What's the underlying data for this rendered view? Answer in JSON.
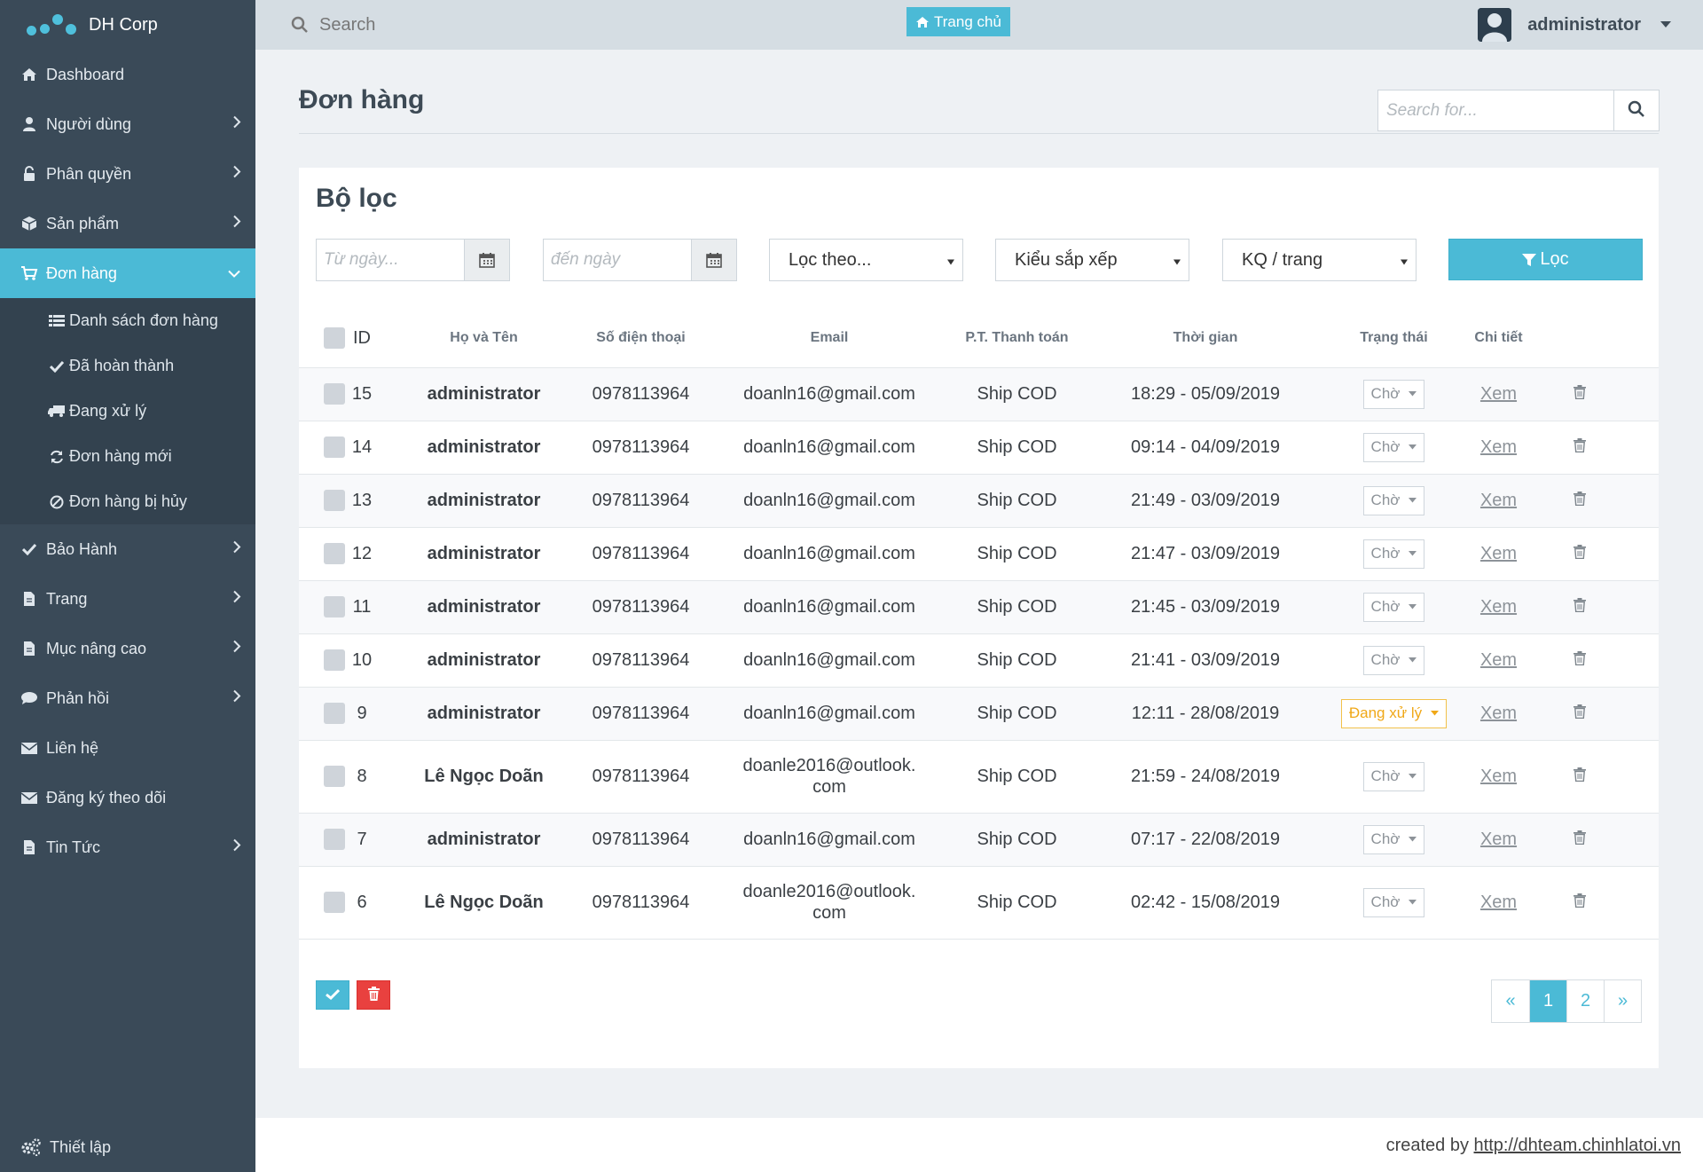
{
  "brand": {
    "name": "DH Corp",
    "logo_color": "#4fc0dc"
  },
  "sidebar": {
    "items": [
      {
        "label": "Dashboard",
        "icon": "home-icon"
      },
      {
        "label": "Người dùng",
        "icon": "user-icon"
      },
      {
        "label": "Phân quyền",
        "icon": "unlock-icon"
      },
      {
        "label": "Sản phẩm",
        "icon": "cube-icon"
      },
      {
        "label": "Đơn hàng",
        "icon": "cart-icon"
      },
      {
        "label": "Bảo Hành",
        "icon": "check-icon"
      },
      {
        "label": "Trang",
        "icon": "file-icon"
      },
      {
        "label": "Mục nâng cao",
        "icon": "file-icon"
      },
      {
        "label": "Phản hồi",
        "icon": "comment-icon"
      },
      {
        "label": "Liên hệ",
        "icon": "envelope-icon"
      },
      {
        "label": "Đăng ký theo dõi",
        "icon": "envelope-icon"
      },
      {
        "label": "Tin Tức",
        "icon": "file-icon"
      }
    ],
    "subitems": [
      {
        "label": "Danh sách đơn hàng",
        "icon": "list-icon"
      },
      {
        "label": "Đã hoàn thành",
        "icon": "check-icon"
      },
      {
        "label": "Đang xử lý",
        "icon": "truck-icon"
      },
      {
        "label": "Đơn hàng mới",
        "icon": "refresh-icon"
      },
      {
        "label": "Đơn hàng bị hủy",
        "icon": "ban-icon"
      }
    ],
    "settings_label": "Thiết lập",
    "accent": "#4bbad6"
  },
  "topbar": {
    "search_label": "Search",
    "home_label": "Trang chủ",
    "username": "administrator"
  },
  "page": {
    "title": "Đơn hàng",
    "search_placeholder": "Search for..."
  },
  "filter": {
    "title": "Bộ lọc",
    "from_placeholder": "Từ ngày...",
    "to_placeholder": "đến ngày",
    "filter_by": "Lọc theo...",
    "sort_type": "Kiểu sắp xếp",
    "per_page": "KQ / trang",
    "button_label": "Lọc"
  },
  "table": {
    "headers": [
      "ID",
      "Họ và Tên",
      "Số điện thoại",
      "Email",
      "P.T. Thanh toán",
      "Thời gian",
      "Trạng thái",
      "Chi tiết"
    ],
    "detail_label": "Xem",
    "rows": [
      {
        "id": "15",
        "name": "administrator",
        "phone": "0978113964",
        "email_1": "doanln16@gmail.com",
        "email_2": "",
        "payment": "Ship COD",
        "time": "18:29 - 05/09/2019",
        "status": "Chờ"
      },
      {
        "id": "14",
        "name": "administrator",
        "phone": "0978113964",
        "email_1": "doanln16@gmail.com",
        "email_2": "",
        "payment": "Ship COD",
        "time": "09:14 - 04/09/2019",
        "status": "Chờ"
      },
      {
        "id": "13",
        "name": "administrator",
        "phone": "0978113964",
        "email_1": "doanln16@gmail.com",
        "email_2": "",
        "payment": "Ship COD",
        "time": "21:49 - 03/09/2019",
        "status": "Chờ"
      },
      {
        "id": "12",
        "name": "administrator",
        "phone": "0978113964",
        "email_1": "doanln16@gmail.com",
        "email_2": "",
        "payment": "Ship COD",
        "time": "21:47 - 03/09/2019",
        "status": "Chờ"
      },
      {
        "id": "11",
        "name": "administrator",
        "phone": "0978113964",
        "email_1": "doanln16@gmail.com",
        "email_2": "",
        "payment": "Ship COD",
        "time": "21:45 - 03/09/2019",
        "status": "Chờ"
      },
      {
        "id": "10",
        "name": "administrator",
        "phone": "0978113964",
        "email_1": "doanln16@gmail.com",
        "email_2": "",
        "payment": "Ship COD",
        "time": "21:41 - 03/09/2019",
        "status": "Chờ"
      },
      {
        "id": "9",
        "name": "administrator",
        "phone": "0978113964",
        "email_1": "doanln16@gmail.com",
        "email_2": "",
        "payment": "Ship COD",
        "time": "12:11 - 28/08/2019",
        "status": "Đang xử lý"
      },
      {
        "id": "8",
        "name": "Lê Ngọc Doãn",
        "phone": "0978113964",
        "email_1": "doanle2016@outlook.",
        "email_2": "com",
        "payment": "Ship COD",
        "time": "21:59 - 24/08/2019",
        "status": "Chờ"
      },
      {
        "id": "7",
        "name": "administrator",
        "phone": "0978113964",
        "email_1": "doanln16@gmail.com",
        "email_2": "",
        "payment": "Ship COD",
        "time": "07:17 - 22/08/2019",
        "status": "Chờ"
      },
      {
        "id": "6",
        "name": "Lê Ngọc Doãn",
        "phone": "0978113964",
        "email_1": "doanle2016@outlook.",
        "email_2": "com",
        "payment": "Ship COD",
        "time": "02:42 - 15/08/2019",
        "status": "Chờ"
      }
    ]
  },
  "pagination": {
    "prev": "«",
    "pages": [
      "1",
      "2"
    ],
    "current": "1",
    "next": "»"
  },
  "footer": {
    "prefix": "created by ",
    "link": "http://dhteam.chinhlatoi.vn"
  },
  "colors": {
    "accent": "#4bbad6",
    "danger": "#e9413f",
    "warning": "#f0a818",
    "sidebar": "#3a4a58"
  }
}
